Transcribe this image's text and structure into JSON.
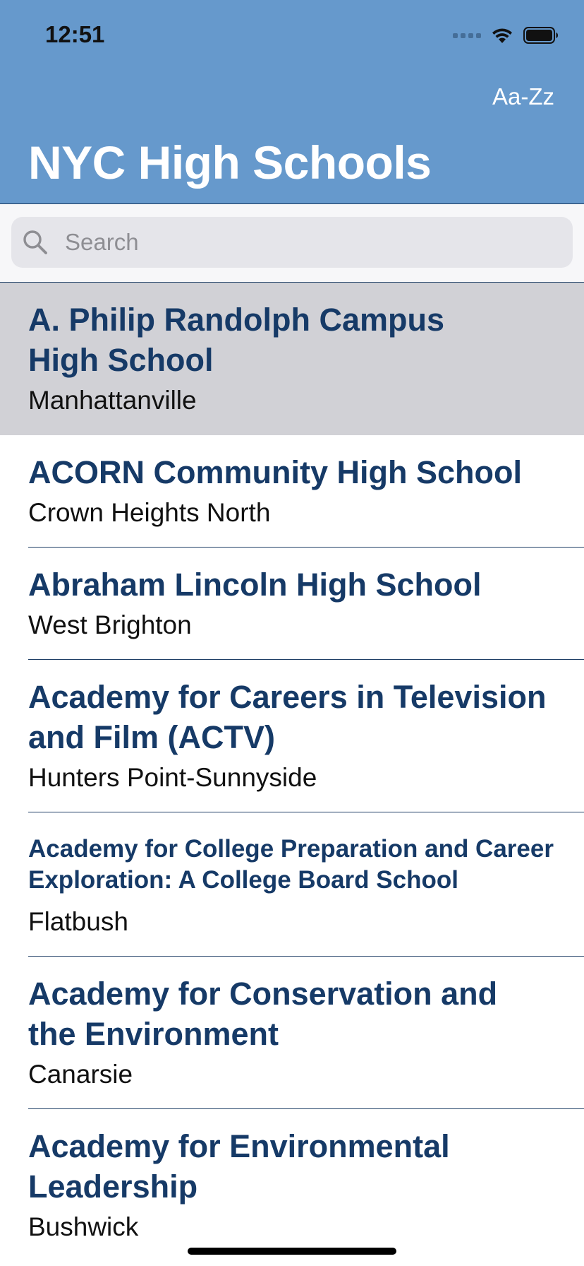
{
  "status_bar": {
    "time": "12:51"
  },
  "nav": {
    "sort_label": "Aa-Zz",
    "title": "NYC High Schools"
  },
  "search": {
    "placeholder": "Search",
    "value": ""
  },
  "colors": {
    "header_bg": "#6699cc",
    "school_name": "#163a67",
    "selected_row_bg": "#d1d1d6"
  },
  "schools": [
    {
      "name": "A. Philip Randolph Campus High School",
      "neighborhood": "Manhattanville"
    },
    {
      "name": "ACORN Community High School",
      "neighborhood": "Crown Heights North"
    },
    {
      "name": "Abraham Lincoln High School",
      "neighborhood": "West Brighton"
    },
    {
      "name": "Academy for Careers in Television and Film (ACTV)",
      "neighborhood": "Hunters Point-Sunnyside"
    },
    {
      "name": "Academy for College Preparation and Career Exploration: A College Board School",
      "neighborhood": "Flatbush"
    },
    {
      "name": "Academy for Conservation and the Environment",
      "neighborhood": "Canarsie"
    },
    {
      "name": "Academy for Environmental Leadership",
      "neighborhood": "Bushwick"
    }
  ]
}
